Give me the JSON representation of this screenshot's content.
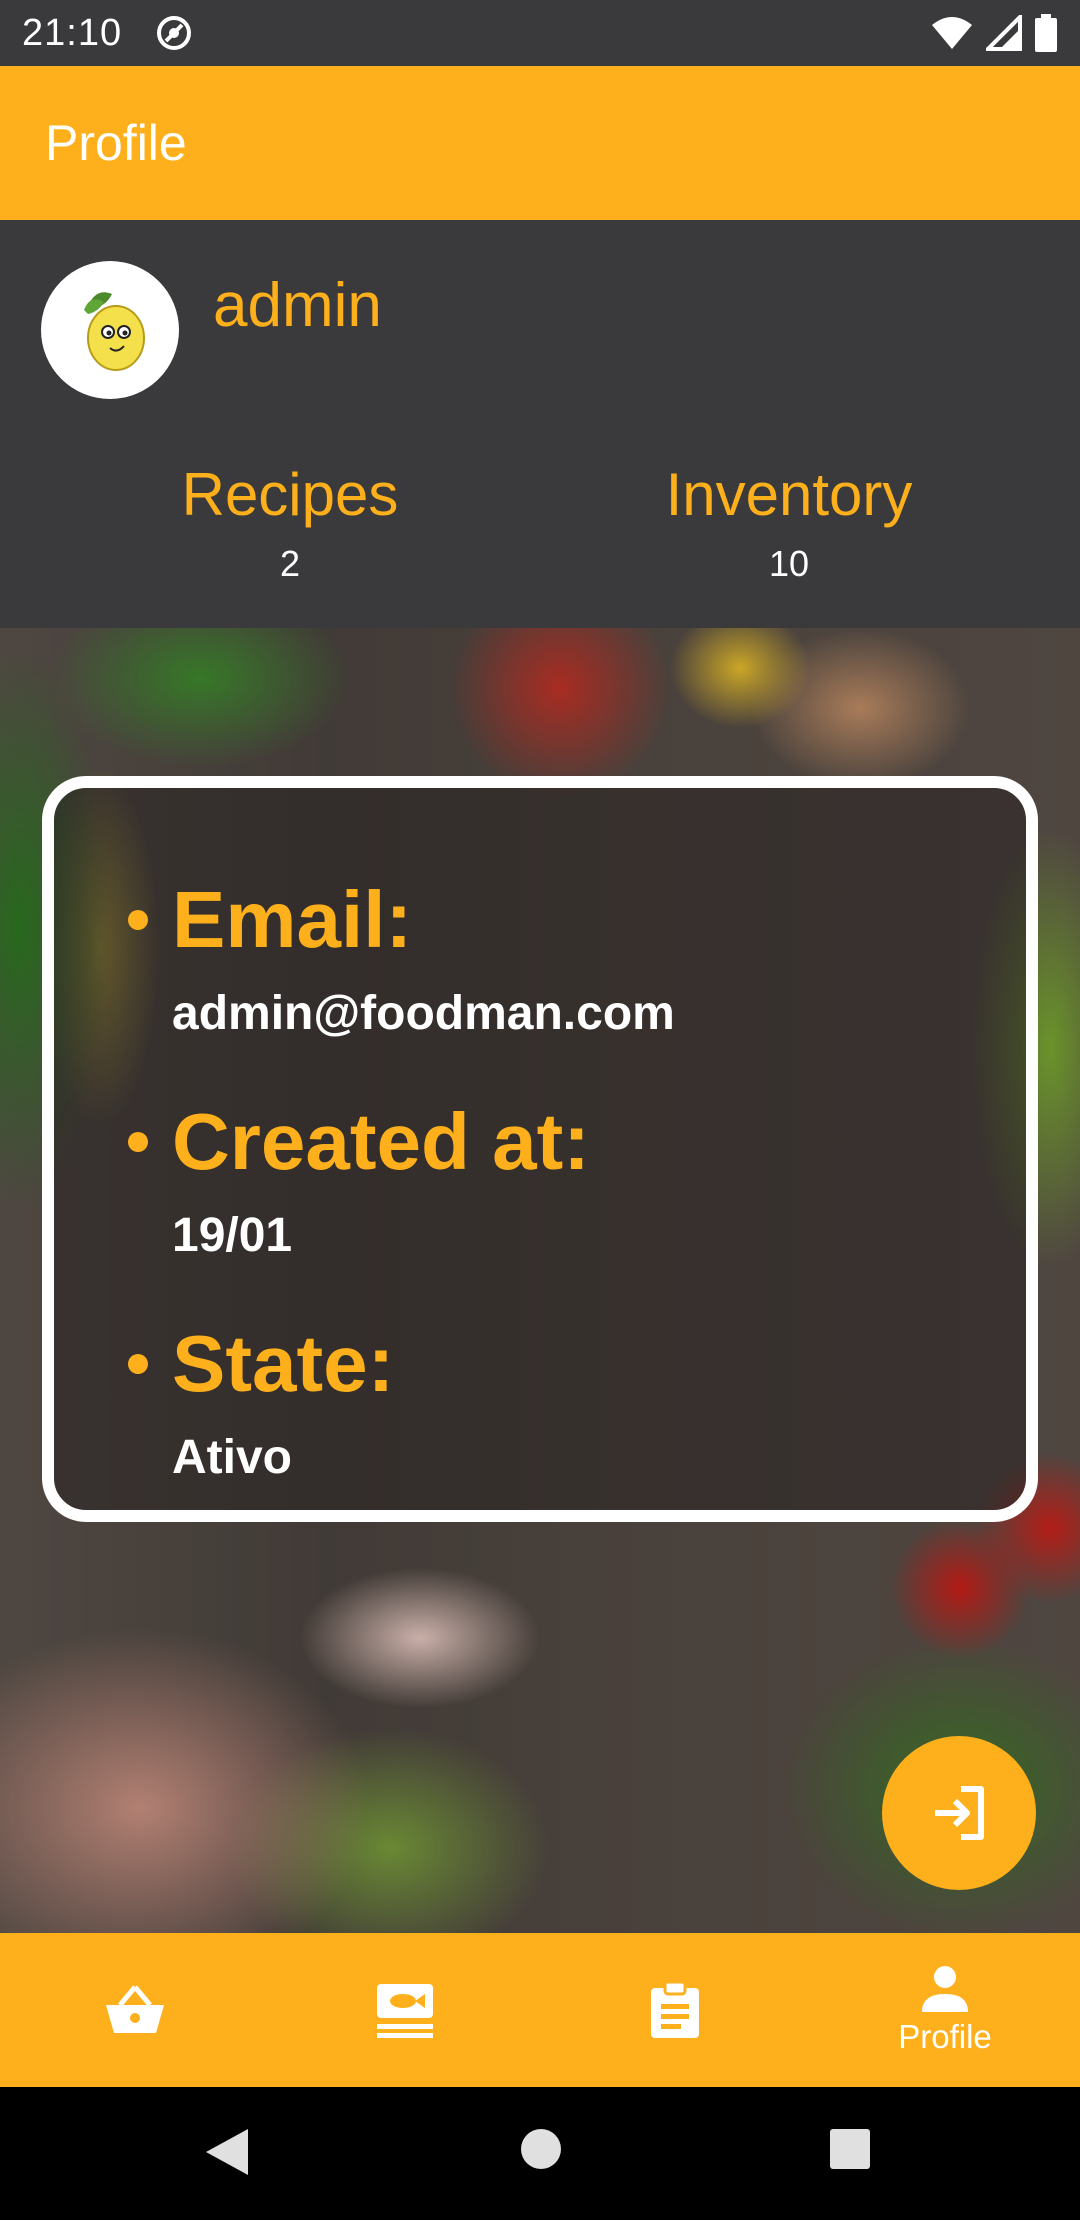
{
  "status_bar": {
    "time": "21:10",
    "icons": [
      "sync-icon",
      "wifi-icon",
      "signal-icon",
      "battery-icon"
    ]
  },
  "app_bar": {
    "title": "Profile"
  },
  "profile": {
    "username": "admin",
    "stats": [
      {
        "label": "Recipes",
        "value": "2"
      },
      {
        "label": "Inventory",
        "value": "10"
      }
    ]
  },
  "info_card": {
    "email_label": "Email:",
    "email_value": "admin@foodman.com",
    "created_label": "Created at:",
    "created_value": "19/01",
    "state_label": "State:",
    "state_value": "Ativo"
  },
  "fab": {
    "icon": "login-icon"
  },
  "bottom_nav": {
    "items": [
      {
        "icon": "basket-icon",
        "label": ""
      },
      {
        "icon": "fish-menu-icon",
        "label": ""
      },
      {
        "icon": "clipboard-icon",
        "label": ""
      },
      {
        "icon": "person-icon",
        "label": "Profile",
        "active": true
      }
    ]
  },
  "colors": {
    "accent": "#fdb01b",
    "header_bg": "#3a3a3c",
    "text_light": "#ffffff"
  }
}
